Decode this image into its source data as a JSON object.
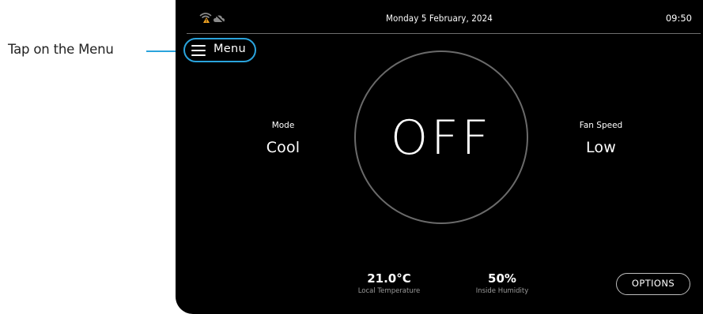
{
  "annotation": {
    "callout_text": "Tap on the Menu",
    "accent_color": "#2aa3dc"
  },
  "status_bar": {
    "date": "Monday 5 February, 2024",
    "time": "09:50",
    "icons": [
      "wifi-warning-icon",
      "cloud-off-icon"
    ]
  },
  "menu": {
    "label": "Menu",
    "icon": "hamburger-menu-icon"
  },
  "mode": {
    "caption": "Mode",
    "value": "Cool"
  },
  "power": {
    "state": "OFF"
  },
  "fan": {
    "caption": "Fan Speed",
    "value": "Low"
  },
  "readings": {
    "temperature_value": "21.0°C",
    "temperature_label": "Local Temperature",
    "humidity_value": "50%",
    "humidity_label": "Inside Humidity"
  },
  "options": {
    "label": "OPTIONS"
  },
  "colors": {
    "screen_background": "#000000",
    "warning_icon": "#f5a623",
    "text": "#ffffff",
    "muted_text": "#9a9a9a"
  }
}
